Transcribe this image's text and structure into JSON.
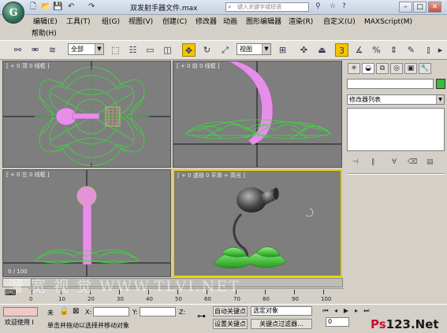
{
  "app": {
    "title": "双发射手器文件.max",
    "search_placeholder": "键入关键字或短语",
    "quick_access": [
      "🗋",
      "📂",
      "💾",
      "↶",
      "↷"
    ],
    "logo": "G"
  },
  "menu": {
    "items": [
      "编辑(E)",
      "工具(T)",
      "组(G)",
      "视图(V)",
      "创建(C)",
      "修改器",
      "动画",
      "图形编辑器",
      "渲染(R)",
      "自定义(U)",
      "MAXScript(M)",
      "帮助(H)"
    ]
  },
  "toolbar": {
    "selection_filter": "全部",
    "reference_coord": "视图"
  },
  "viewports": {
    "top": "[ + 0 顶 0 线框 ]",
    "front": "[ + 0 前 0 线框 ]",
    "left": "[ + 0 左 0 线框 ]",
    "perspective": "[ + 0 透视 0 平滑 + 高光 ]"
  },
  "command_panel": {
    "modifier_list": "修改器列表",
    "name_value": "",
    "object_color": "#3cb83c"
  },
  "time_slider": {
    "frame_label": "0 / 100",
    "ticks": [
      "0",
      "10",
      "20",
      "30",
      "40",
      "50",
      "60",
      "70",
      "80",
      "90",
      "100"
    ]
  },
  "status": {
    "welcome": "欢迎使用 I",
    "selection_label": "未",
    "prompt": "单击并拖动以选择并移动对象",
    "x_label": "X:",
    "y_label": "Y:",
    "z_label": "Z:",
    "auto_key": "自动关键点",
    "set_key": "设置关键点",
    "selected_object": "选定对象",
    "key_filters": "关键点过滤器...",
    "frame_field": "0"
  },
  "watermark": "溜 宽 视 觉   WWW.TLVI.NET",
  "corner_logo": "Ps123.Net"
}
